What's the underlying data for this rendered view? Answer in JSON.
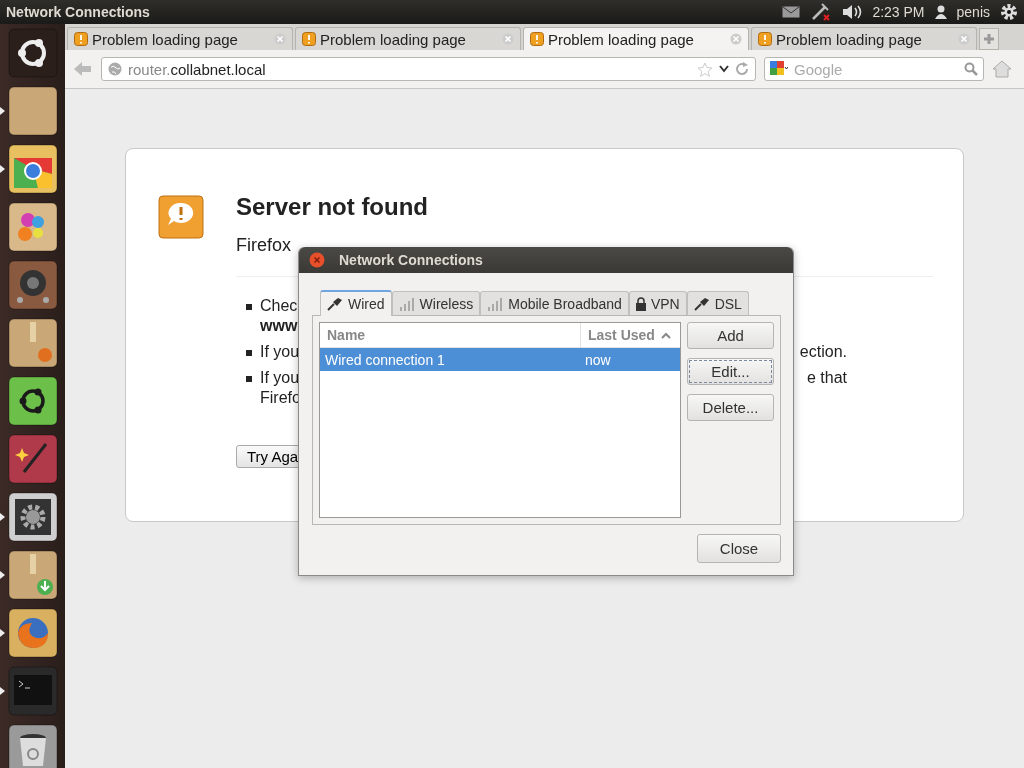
{
  "top_panel": {
    "title": "Network Connections",
    "time": "2:23 PM",
    "user": "penis"
  },
  "launcher": [
    {
      "kind": "home",
      "running": false
    },
    {
      "kind": "files",
      "running": true
    },
    {
      "kind": "chrome",
      "running": true
    },
    {
      "kind": "paint",
      "running": false
    },
    {
      "kind": "speaker",
      "running": false
    },
    {
      "kind": "package",
      "running": false
    },
    {
      "kind": "software",
      "running": false
    },
    {
      "kind": "wand",
      "running": false
    },
    {
      "kind": "settings",
      "running": true
    },
    {
      "kind": "download",
      "running": true
    },
    {
      "kind": "firefox",
      "running": true
    },
    {
      "kind": "terminal",
      "running": true
    },
    {
      "kind": "trash",
      "running": false
    }
  ],
  "browser": {
    "tabs": [
      {
        "label": "Problem loading page",
        "selected": false
      },
      {
        "label": "Problem loading page",
        "selected": false
      },
      {
        "label": "Problem loading page",
        "selected": true
      },
      {
        "label": "Problem loading page",
        "selected": false
      }
    ],
    "url_prefix": "router.",
    "url_host": "collabnet.local",
    "search": {
      "placeholder": "Google"
    }
  },
  "error_page": {
    "title": "Server not found",
    "intro": "Firefox",
    "bullets": [
      {
        "left": "Chec",
        "second": "www"
      },
      {
        "left": "If you",
        "right": "ection."
      },
      {
        "left": "If you",
        "second": "Firefo",
        "right": "e that"
      }
    ],
    "button": "Try Aga"
  },
  "dialog": {
    "title": "Network Connections",
    "tabs": [
      {
        "label": "Wired",
        "kind": "plug",
        "selected": true
      },
      {
        "label": "Wireless",
        "kind": "bars",
        "selected": false
      },
      {
        "label": "Mobile Broadband",
        "kind": "bars",
        "selected": false
      },
      {
        "label": "VPN",
        "kind": "lock",
        "selected": false
      },
      {
        "label": "DSL",
        "kind": "plug",
        "selected": false
      }
    ],
    "columns": [
      {
        "label": "Name",
        "sorted": false
      },
      {
        "label": "Last Used",
        "sorted": true
      }
    ],
    "rows": [
      {
        "name": "Wired connection 1",
        "last_used": "now",
        "selected": true
      }
    ],
    "buttons": [
      {
        "label": "Add",
        "focused": false
      },
      {
        "label": "Edit...",
        "focused": true
      },
      {
        "label": "Delete...",
        "focused": false
      }
    ],
    "close": "Close"
  }
}
